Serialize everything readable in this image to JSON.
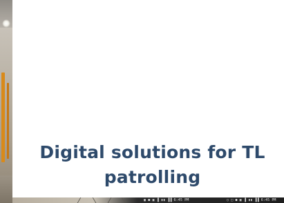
{
  "headline": {
    "line1": "Digital solutions for TL",
    "line2": "patrolling"
  },
  "status_bars": {
    "left": "▣ ●    ▣ ▐ ▮▮ ▐▐ 6:45 PM",
    "right": "○ □ ●      ▣ ▐ ▮▮ ▐▐ 6:45 PM"
  },
  "colors": {
    "headline": "#2e4a6b",
    "background": "#ffffff",
    "beam_accent": "#d98a1a"
  },
  "icons": [
    "status-bar-icons"
  ]
}
